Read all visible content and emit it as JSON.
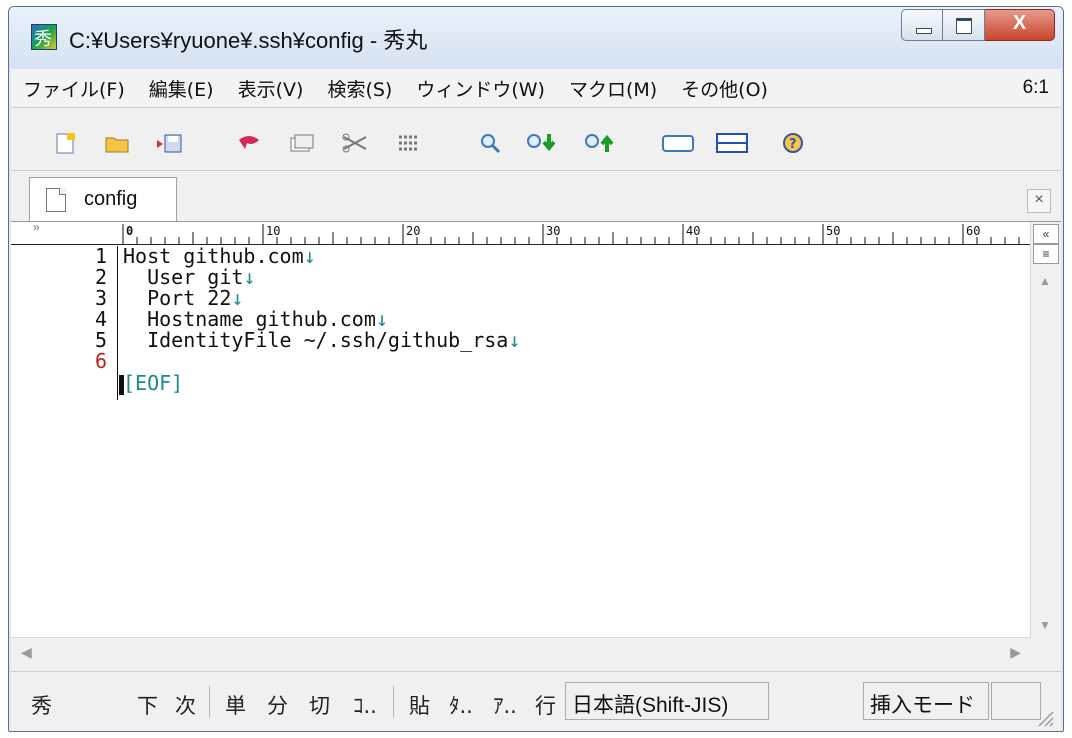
{
  "window": {
    "title": "C:¥Users¥ryuone¥.ssh¥config  - 秀丸",
    "controls": {
      "minimize": "minimize",
      "maximize": "maximize",
      "close": "X"
    }
  },
  "menu": {
    "items": [
      "ファイル(F)",
      "編集(E)",
      "表示(V)",
      "検索(S)",
      "ウィンドウ(W)",
      "マクロ(M)",
      "その他(O)"
    ],
    "cursor_position": "6:1"
  },
  "toolbar": {
    "buttons": [
      "new-file-icon",
      "open-folder-icon",
      "save-icon",
      "undo-icon",
      "copy-icon",
      "cut-icon",
      "paste-icon",
      "search-icon",
      "search-next-icon",
      "search-prev-icon",
      "window-icon",
      "split-icon",
      "help-icon"
    ]
  },
  "tabs": [
    {
      "label": "config",
      "active": true
    }
  ],
  "tab_close": "×",
  "ruler": {
    "prefix": "»",
    "marks": [
      "0",
      "10",
      "20",
      "30",
      "40",
      "50",
      "60"
    ]
  },
  "editor": {
    "lines": [
      {
        "number": "1",
        "text": "Host github.com"
      },
      {
        "number": "2",
        "text": "  User git"
      },
      {
        "number": "3",
        "text": "  Port 22"
      },
      {
        "number": "4",
        "text": "  Hostname github.com"
      },
      {
        "number": "5",
        "text": "  IdentityFile ~/.ssh/github_rsa"
      },
      {
        "number": "6",
        "text": ""
      }
    ],
    "eol_marker": "↓",
    "eof_marker": "[EOF]",
    "current_line": 6
  },
  "scroll": {
    "top_btn": "«",
    "list_btn": "≡",
    "up": "▲",
    "down": "▼",
    "left": "◀",
    "right": "▶"
  },
  "statusbar": {
    "hide": "秀",
    "buttons": [
      "下",
      "次",
      "単",
      "分",
      "切",
      "ｺ..",
      "貼",
      "ﾀ..",
      "ｱ..",
      "行"
    ],
    "encoding": "日本語(Shift-JIS)",
    "mode": "挿入モード"
  },
  "colors": {
    "eol": "#1c8a8a",
    "current_line_number": "#c02020",
    "close_button": "#c9452d"
  }
}
